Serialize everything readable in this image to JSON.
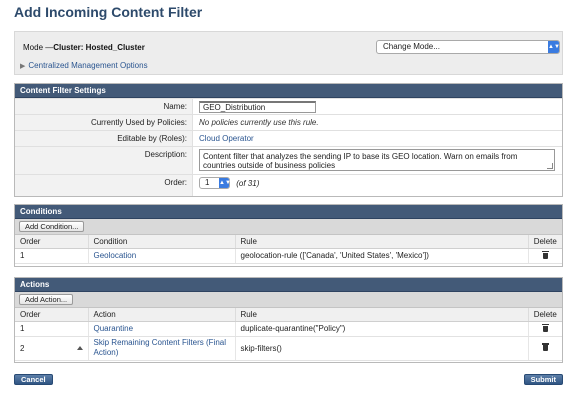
{
  "page": {
    "title": "Add Incoming Content Filter"
  },
  "mode": {
    "prefix": "Mode —",
    "value": "Cluster: Hosted_Cluster",
    "change_mode_label": "Change Mode...",
    "centralized_label": "Centralized Management Options"
  },
  "settings": {
    "header": "Content Filter Settings",
    "name_label": "Name:",
    "name_value": "GEO_Distribution",
    "used_by_label": "Currently Used by Policies:",
    "used_by_value": "No policies currently use this rule.",
    "editable_label": "Editable by (Roles):",
    "editable_value": "Cloud Operator",
    "description_label": "Description:",
    "description_value": "Content filter that analyzes the sending IP to base its GEO location. Warn on emails from countries outside of business policies",
    "order_label": "Order:",
    "order_value": "1",
    "order_of": "(of 31)"
  },
  "conditions": {
    "header": "Conditions",
    "add_button": "Add Condition...",
    "columns": [
      "Order",
      "Condition",
      "Rule",
      "Delete"
    ],
    "rows": [
      {
        "order": "1",
        "condition": "Geolocation",
        "rule": "geolocation-rule (['Canada', 'United States', 'Mexico'])"
      }
    ]
  },
  "actions": {
    "header": "Actions",
    "add_button": "Add Action...",
    "columns": [
      "Order",
      "Action",
      "Rule",
      "Delete"
    ],
    "rows": [
      {
        "order": "1",
        "action": "Quarantine",
        "rule": "duplicate-quarantine(\"Policy\")"
      },
      {
        "order": "2",
        "action": "Skip Remaining Content Filters (Final Action)",
        "rule": "skip-filters()"
      }
    ]
  },
  "footer": {
    "cancel_label": "Cancel",
    "submit_label": "Submit"
  },
  "icons": {
    "delete": "trash-icon",
    "move_up": "up-arrow-icon",
    "disclosure": "triangle-right-icon"
  },
  "colors": {
    "header_bg": "#435a78",
    "link": "#2a5590",
    "title": "#2d4a6b",
    "button_blue": "#2f5583"
  }
}
